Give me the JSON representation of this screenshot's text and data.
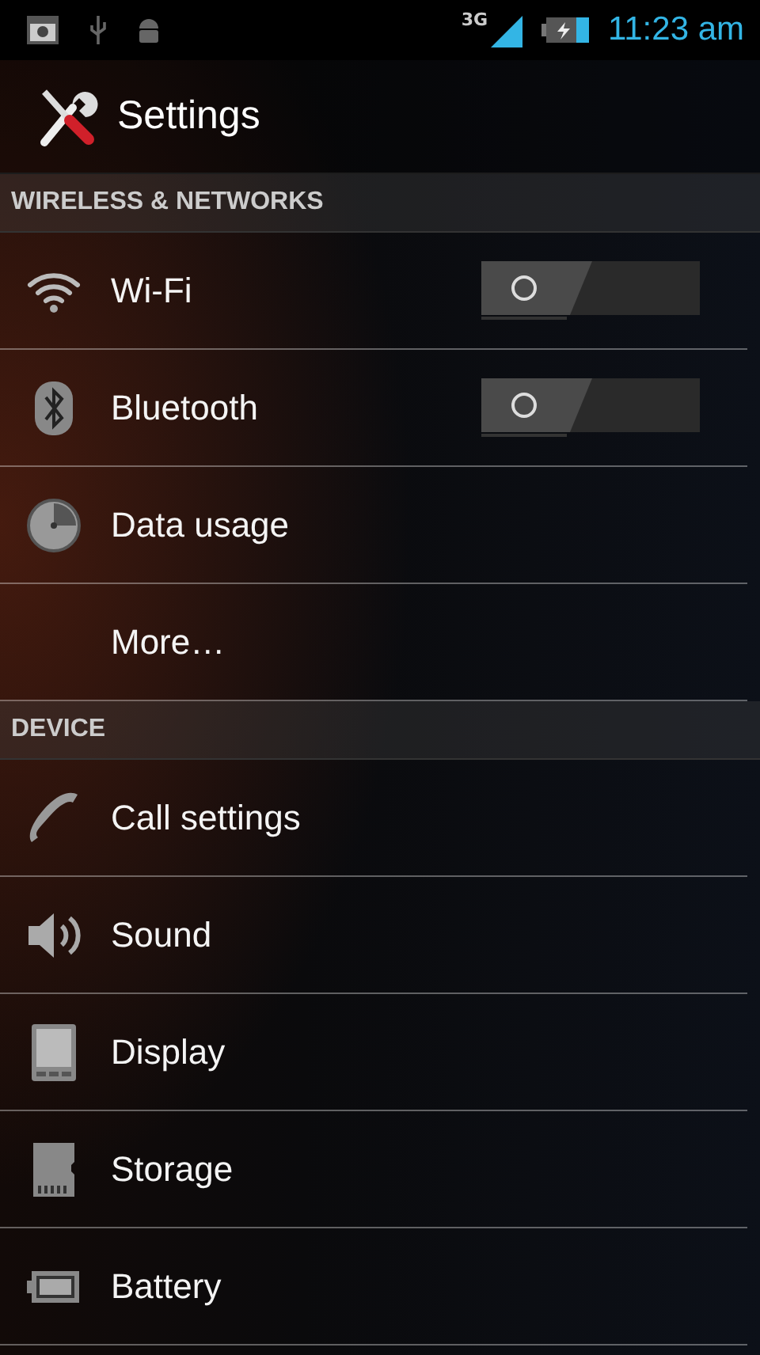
{
  "status_bar": {
    "network": "3G",
    "time": "11:23 am"
  },
  "action_bar": {
    "title": "Settings"
  },
  "sections": [
    {
      "header": "WIRELESS & NETWORKS",
      "items": [
        {
          "label": "Wi-Fi",
          "kind": "toggle",
          "on": false
        },
        {
          "label": "Bluetooth",
          "kind": "toggle",
          "on": false
        },
        {
          "label": "Data usage",
          "kind": "plain"
        },
        {
          "label": "More…",
          "kind": "plain"
        }
      ]
    },
    {
      "header": "DEVICE",
      "items": [
        {
          "label": "Call settings",
          "kind": "plain"
        },
        {
          "label": "Sound",
          "kind": "plain"
        },
        {
          "label": "Display",
          "kind": "plain"
        },
        {
          "label": "Storage",
          "kind": "plain"
        },
        {
          "label": "Battery",
          "kind": "plain"
        }
      ]
    }
  ]
}
